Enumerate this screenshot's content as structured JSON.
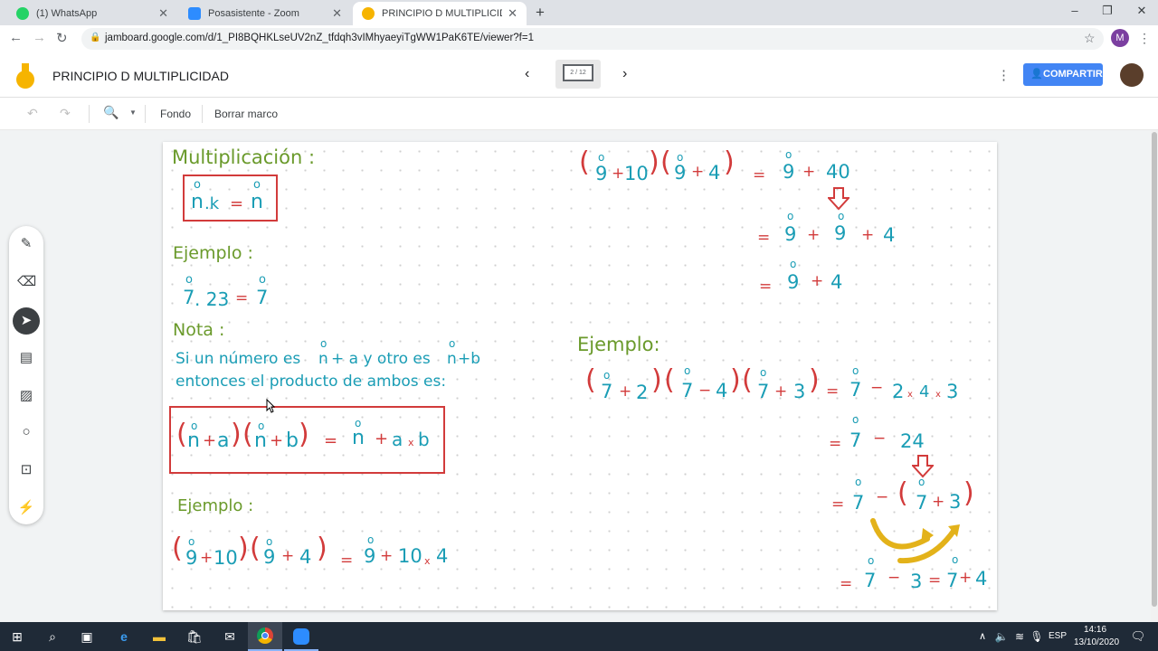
{
  "browser": {
    "tabs": [
      {
        "title": "(1) WhatsApp",
        "color": "#25d366"
      },
      {
        "title": "Posasistente - Zoom",
        "color": "#2d8cff"
      },
      {
        "title": "PRINCIPIO D MULTIPLICIDAD - G",
        "color": "#f6b400"
      }
    ],
    "url": "jamboard.google.com/d/1_PI8BQHKLseUV2nZ_tfdqh3vIMhyaeyiTgWW1PaK6TE/viewer?f=1",
    "profile_initial": "M"
  },
  "jam": {
    "title": "PRINCIPIO D MULTIPLICIDAD",
    "frame_counter": "2 / 12",
    "share_label": "COMPARTIR",
    "fondo_label": "Fondo",
    "clear_label": "Borrar marco"
  },
  "board": {
    "heading_mult": "Multiplicación :",
    "example1_label": "Ejemplo :",
    "note_label": "Nota :",
    "note_line1a": "Si un número es",
    "note_line1b": "+ a  y otro es",
    "note_line1c": "+b",
    "note_line2": "entonces el producto de ambos es:",
    "example2_label": "Ejemplo :",
    "example3_label": "Ejemplo:",
    "dot": "o",
    "n": "n",
    "k": ".k",
    "eq": "=",
    "n7": "7",
    "n23": ". 23",
    "n9": "9",
    "plus": "+",
    "minus": "−",
    "times": "x",
    "ten": "10",
    "four": "4",
    "forty": "40",
    "two": "2",
    "three": "3",
    "twentyfour": "24",
    "a": "a",
    "b": "b",
    "lp": "(",
    "rp": ")"
  },
  "taskbar": {
    "lang": "ESP",
    "time": "14:16",
    "date": "13/10/2020"
  },
  "colors": {
    "green": "#6a9a2b",
    "teal": "#1a9db5",
    "red": "#d23b3b"
  }
}
